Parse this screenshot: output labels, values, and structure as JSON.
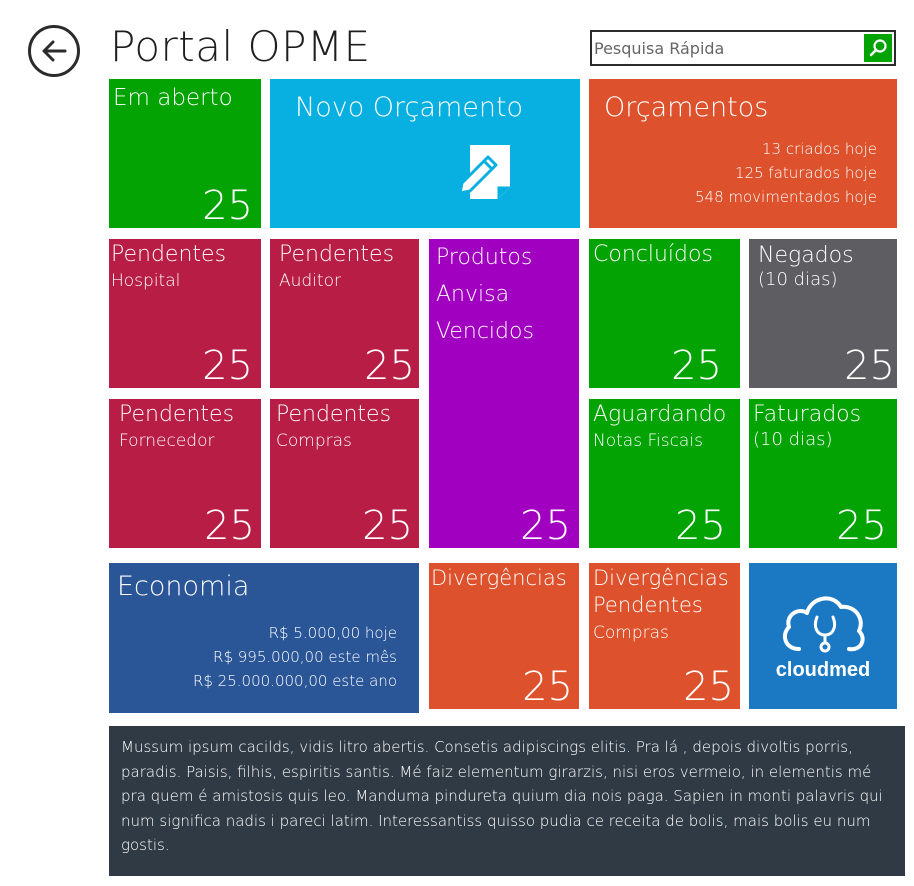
{
  "header": {
    "title": "Portal OPME",
    "search_placeholder": "Pesquisa Rápida",
    "back_icon": "arrow-left-circle-icon",
    "search_icon": "search-icon"
  },
  "colors": {
    "green": "#03a303",
    "cyan": "#07b0e0",
    "orange": "#dd522c",
    "crimson": "#b81d45",
    "purple": "#a100c0",
    "gray": "#5e5e62",
    "navy": "#2a5697",
    "blue": "#1b79c4",
    "panel": "#2f3a44"
  },
  "tiles": {
    "em_aberto": {
      "title": "Em aberto",
      "count": "25"
    },
    "novo_orcamento": {
      "title": "Novo Orçamento",
      "icon": "edit-document-icon"
    },
    "orcamentos": {
      "title": "Orçamentos",
      "lines": [
        "13 criados hoje",
        "125 faturados hoje",
        "548 movimentados hoje"
      ]
    },
    "pendentes_hospital": {
      "title": "Pendentes",
      "subtitle": "Hospital",
      "count": "25"
    },
    "pendentes_auditor": {
      "title": "Pendentes",
      "subtitle": "Auditor",
      "count": "25"
    },
    "produtos_anvisa": {
      "lines": [
        "Produtos",
        "Anvisa",
        "Vencidos"
      ],
      "count": "25"
    },
    "concluidos": {
      "title": "Concluídos",
      "count": "25"
    },
    "negados": {
      "title": "Negados",
      "subtitle": "(10 dias)",
      "count": "25"
    },
    "pendentes_fornecedor": {
      "title": "Pendentes",
      "subtitle": "Fornecedor",
      "count": "25"
    },
    "pendentes_compras": {
      "title": "Pendentes",
      "subtitle": "Compras",
      "count": "25"
    },
    "aguardando": {
      "title": "Aguardando",
      "subtitle": "Notas Fiscais",
      "count": "25"
    },
    "faturados": {
      "title": "Faturados",
      "subtitle": "(10 dias)",
      "count": "25"
    },
    "economia": {
      "title": "Economia",
      "lines": [
        "R$ 5.000,00 hoje",
        "R$ 995.000,00 este mês",
        "R$ 25.000.000,00 este ano"
      ]
    },
    "divergencias": {
      "title": "Divergências",
      "count": "25"
    },
    "divergencias_pendentes": {
      "lines": [
        "Divergências",
        "Pendentes"
      ],
      "subtitle": "Compras",
      "count": "25"
    },
    "cloudmed": {
      "label": "cloudmed",
      "icon": "cloud-stethoscope-icon"
    }
  },
  "info_panel": {
    "text": "Mussum ipsum cacilds, vidis litro abertis. Consetis adipiscings elitis. Pra lá , depois divoltis porris, paradis. Paisis, filhis, espiritis santis. Mé faiz elementum girarzis, nisi eros vermeio, in elementis mé pra quem é amistosis quis leo. Manduma pindureta quium dia nois paga. Sapien in monti palavris qui num significa nadis i pareci latim. Interessantiss quisso pudia ce receita de bolis, mais bolis eu num gostis."
  }
}
